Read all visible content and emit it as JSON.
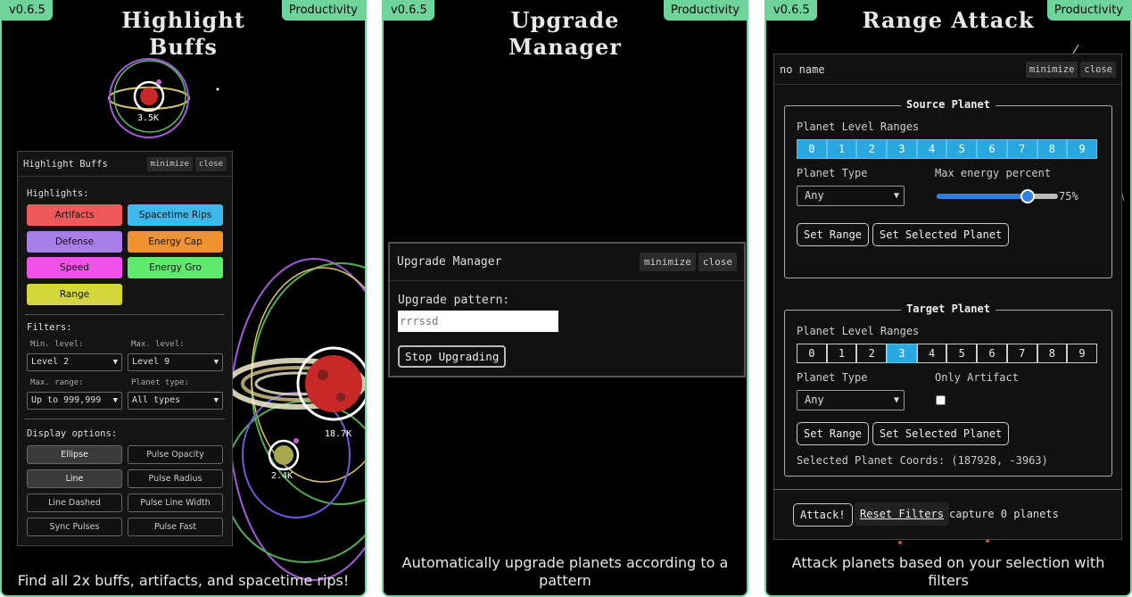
{
  "cards": [
    {
      "version": "v0.6.5",
      "category": "Productivity",
      "title_line1": "Highlight",
      "title_line2": "Buffs",
      "description": "Find all 2x buffs, artifacts, and spacetime rips!"
    },
    {
      "version": "v0.6.5",
      "category": "Productivity",
      "title_line1": "Upgrade",
      "title_line2": "Manager",
      "description": "Automatically upgrade planets according to a pattern"
    },
    {
      "version": "v0.6.5",
      "category": "Productivity",
      "title_line1": "Range Attack",
      "description": "Attack planets based on your selection with filters"
    }
  ],
  "planet_labels": {
    "top": "3.5K",
    "big": "18.7K",
    "small": "2.4K"
  },
  "highlight_buffs": {
    "window_title": "Highlight Buffs",
    "minimize": "minimize",
    "close": "close",
    "highlights_label": "Highlights:",
    "highlights": [
      {
        "label": "Artifacts",
        "color": "#ee5a5a"
      },
      {
        "label": "Spacetime Rips",
        "color": "#3fb8ec"
      },
      {
        "label": "Defense",
        "color": "#a87ee8"
      },
      {
        "label": "Energy Cap",
        "color": "#f0922e"
      },
      {
        "label": "Speed",
        "color": "#ee52e8"
      },
      {
        "label": "Energy Gro",
        "color": "#5eea6c"
      },
      {
        "label": "Range",
        "color": "#d4d63a"
      }
    ],
    "filters_label": "Filters:",
    "min_level_label": "Min. level:",
    "min_level_value": "Level 2",
    "max_level_label": "Max. level:",
    "max_level_value": "Level 9",
    "max_range_label": "Max. range:",
    "max_range_value": "Up to 999,999",
    "planet_type_label": "Planet type:",
    "planet_type_value": "All types",
    "display_label": "Display options:",
    "display_options": [
      {
        "label": "Ellipse",
        "active": true
      },
      {
        "label": "Pulse Opacity",
        "active": false
      },
      {
        "label": "Line",
        "active": true
      },
      {
        "label": "Pulse Radius",
        "active": false
      },
      {
        "label": "Line Dashed",
        "active": false
      },
      {
        "label": "Pulse Line Width",
        "active": false
      },
      {
        "label": "Sync Pulses",
        "active": false
      },
      {
        "label": "Pulse Fast",
        "active": false
      }
    ]
  },
  "upgrade_manager": {
    "window_title": "Upgrade Manager",
    "minimize": "minimize",
    "close": "close",
    "pattern_label": "Upgrade pattern:",
    "pattern_placeholder": "rrrssd",
    "stop_button": "Stop Upgrading"
  },
  "range_attack": {
    "window_title": "no name",
    "minimize": "minimize",
    "close": "close",
    "source": {
      "legend": "Source Planet",
      "levels_label": "Planet Level Ranges",
      "levels": [
        "0",
        "1",
        "2",
        "3",
        "4",
        "5",
        "6",
        "7",
        "8",
        "9"
      ],
      "selected_levels": [
        0,
        1,
        2,
        3,
        4,
        5,
        6,
        7,
        8,
        9
      ],
      "type_label": "Planet Type",
      "type_value": "Any",
      "energy_label": "Max energy percent",
      "energy_percent": 75,
      "energy_text": "75%",
      "set_range": "Set Range",
      "set_selected": "Set Selected Planet"
    },
    "target": {
      "legend": "Target Planet",
      "levels_label": "Planet Level Ranges",
      "levels": [
        "0",
        "1",
        "2",
        "3",
        "4",
        "5",
        "6",
        "7",
        "8",
        "9"
      ],
      "selected_levels": [
        3
      ],
      "type_label": "Planet Type",
      "type_value": "Any",
      "artifact_label": "Only Artifact",
      "only_artifact": false,
      "set_range": "Set Range",
      "set_selected": "Set Selected Planet",
      "coords_text": "Selected Planet Coords: (187928, -3963)"
    },
    "attack_button": "Attack!",
    "reset_button": "Reset Filters",
    "capture_text": "capture 0 planets"
  }
}
